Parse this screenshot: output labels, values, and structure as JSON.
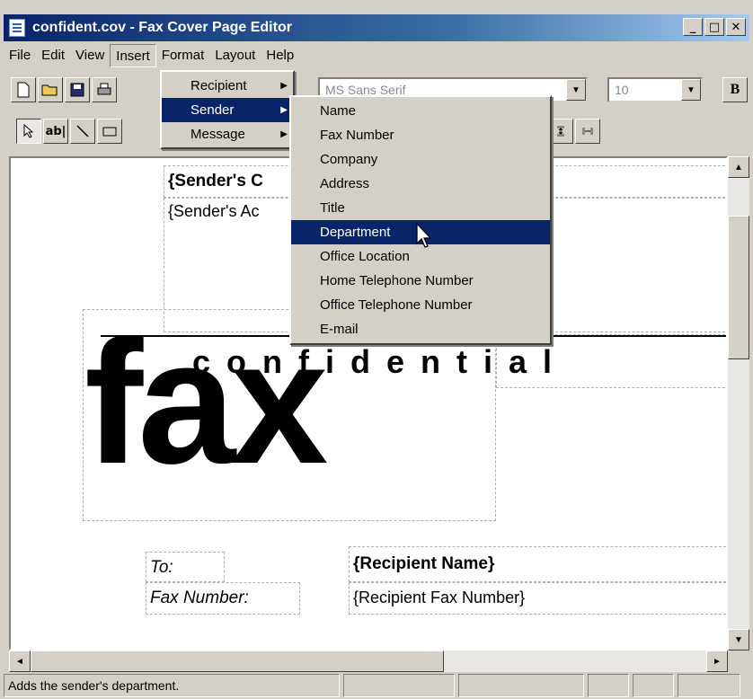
{
  "window": {
    "title": "confident.cov - Fax Cover Page Editor",
    "controls": {
      "minimize": "_",
      "maximize": "□",
      "close": "✕"
    }
  },
  "menubar": {
    "items": [
      {
        "label": "File"
      },
      {
        "label": "Edit"
      },
      {
        "label": "View"
      },
      {
        "label": "Insert"
      },
      {
        "label": "Format"
      },
      {
        "label": "Layout"
      },
      {
        "label": "Help"
      }
    ]
  },
  "toolbar": {
    "font_name": "MS Sans Serif",
    "font_size": "10",
    "bold_label": "B",
    "text_tool_label": "ab|"
  },
  "insert_menu": {
    "items": [
      {
        "label": "Recipient"
      },
      {
        "label": "Sender"
      },
      {
        "label": "Message"
      }
    ],
    "highlighted": "Sender"
  },
  "sender_submenu": {
    "items": [
      {
        "label": "Name"
      },
      {
        "label": "Fax Number"
      },
      {
        "label": "Company"
      },
      {
        "label": "Address"
      },
      {
        "label": "Title"
      },
      {
        "label": "Department"
      },
      {
        "label": "Office Location"
      },
      {
        "label": "Home Telephone Number"
      },
      {
        "label": "Office Telephone Number"
      },
      {
        "label": "E-mail"
      }
    ],
    "highlighted": "Department"
  },
  "document": {
    "sender_company": "{Sender's C",
    "sender_address": "{Sender's Ac",
    "big_word": "fax",
    "banner": "c o n f i d e n t i a l",
    "to_label": "To:",
    "fax_number_label": "Fax Number:",
    "recipient_name": "{Recipient Name}",
    "recipient_fax": "{Recipient Fax Number}"
  },
  "statusbar": {
    "text": "Adds the sender's department."
  },
  "colors": {
    "highlight": "#0a246a",
    "face": "#d4d0c8"
  }
}
